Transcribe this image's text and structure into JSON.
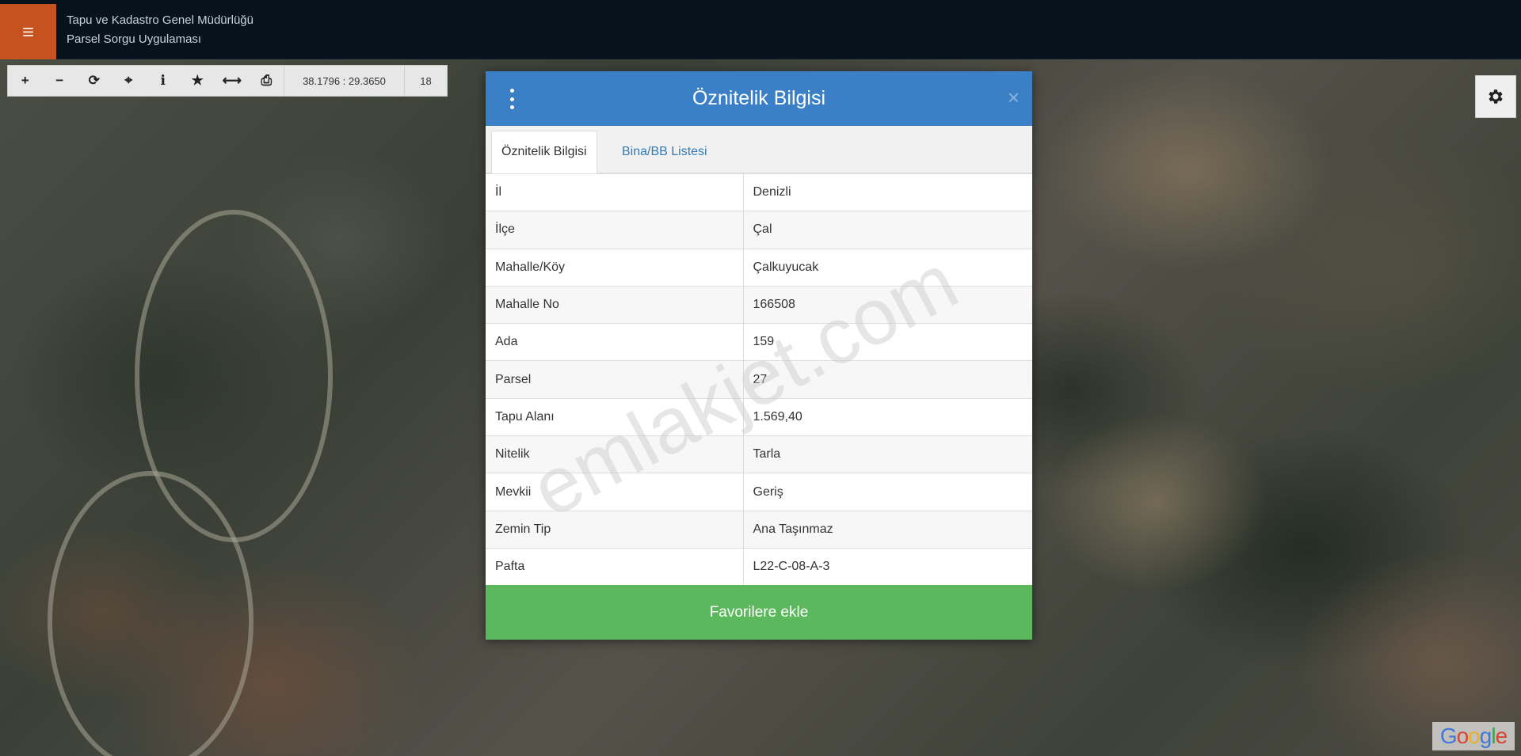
{
  "header": {
    "org_name": "Tapu ve Kadastro Genel Müdürlüğü",
    "app_name": "Parsel Sorgu Uygulaması",
    "menu_icon": "≡"
  },
  "toolbar": {
    "tools": [
      {
        "name": "zoom-in-icon",
        "glyph": "+"
      },
      {
        "name": "zoom-out-icon",
        "glyph": "−"
      },
      {
        "name": "refresh-icon",
        "glyph": "⟳"
      },
      {
        "name": "locate-icon",
        "glyph": "⌖"
      },
      {
        "name": "info-icon",
        "glyph": "i"
      },
      {
        "name": "star-icon",
        "glyph": "★"
      },
      {
        "name": "measure-icon",
        "glyph": "⟷"
      },
      {
        "name": "print-icon",
        "glyph": "⎙"
      }
    ],
    "coordinates": "38.1796 : 29.3650",
    "zoom_level": "18"
  },
  "dialog": {
    "title": "Öznitelik Bilgisi",
    "close_glyph": "×",
    "tabs": [
      {
        "label": "Öznitelik Bilgisi",
        "active": true
      },
      {
        "label": "Bina/BB Listesi",
        "active": false
      }
    ],
    "rows": [
      {
        "key": "İl",
        "value": "Denizli"
      },
      {
        "key": "İlçe",
        "value": "Çal"
      },
      {
        "key": "Mahalle/Köy",
        "value": "Çalkuyucak"
      },
      {
        "key": "Mahalle No",
        "value": "166508"
      },
      {
        "key": "Ada",
        "value": "159"
      },
      {
        "key": "Parsel",
        "value": "27"
      },
      {
        "key": "Tapu Alanı",
        "value": "1.569,40"
      },
      {
        "key": "Nitelik",
        "value": "Tarla"
      },
      {
        "key": "Mevkii",
        "value": "Geriş"
      },
      {
        "key": "Zemin Tip",
        "value": "Ana Taşınmaz"
      },
      {
        "key": "Pafta",
        "value": "L22-C-08-A-3"
      }
    ],
    "favorite_button": "Favorilere ekle"
  },
  "watermark": "emlakjet.com",
  "map_attribution": [
    "G",
    "o",
    "o",
    "g",
    "l",
    "e"
  ],
  "colors": {
    "header_bg": "#07121d",
    "menu_accent": "#c6521f",
    "dialog_header": "#3b80c6",
    "favorite_button": "#5cb85c",
    "link": "#337ab7"
  }
}
